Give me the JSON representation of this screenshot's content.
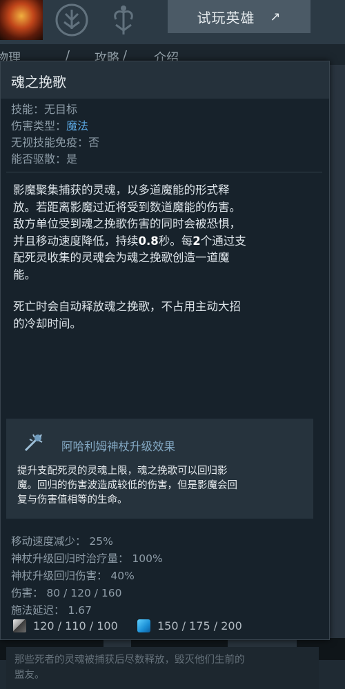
{
  "background": {
    "try_hero_button": "试玩英雄",
    "try_hero_arrow": "↗",
    "tab_fragments": [
      "物理",
      "/",
      "攻略",
      "/",
      "介绍"
    ]
  },
  "tooltip": {
    "title": "魂之挽歌",
    "info": {
      "ability_label": "技能：",
      "ability_value": "无目标",
      "damage_type_label": "伤害类型：",
      "damage_type_value": "魔法",
      "spell_immunity": "无视技能免疫：否",
      "dispellable": "能否驱散：是"
    },
    "description": {
      "p1_lines": [
        "影魔聚集捕获的灵魂，以多道魔能的形式释",
        "放。若距离影魔过近将受到数道魔能的伤害。",
        "敌方单位受到魂之挽歌伤害的同时会被恐惧，"
      ],
      "p1_line4_a": "并且移动速度降低，持续",
      "p1_line4_b": "0.8",
      "p1_line4_c": "秒。每",
      "p1_line4_d": "2",
      "p1_line4_e": "个通过支",
      "p1_lines_end": [
        "配死灵收集的灵魂会为魂之挽歌创造一道魔",
        "能。"
      ],
      "p2_lines": [
        "死亡时会自动释放魂之挽歌，不占用主动大招",
        "的冷却时间。"
      ]
    },
    "aghanim": {
      "icon": "aghanims-scepter-icon",
      "title": "阿哈利姆神杖升级效果",
      "lines": [
        "提升支配死灵的灵魂上限，魂之挽歌可以回归影",
        "魔。回归的伤害波造成较低的伤害，但是影魔会回",
        "复与伤害值相等的生命。"
      ]
    },
    "stats": [
      "移动速度减少： 25%",
      "神杖升级回归时治疗量： 100%",
      "神杖升级回归伤害： 40%",
      "伤害： 80 / 120 / 160",
      "施法延迟： 1.67"
    ],
    "cooldown": "120 / 110 / 100",
    "mana_cost": "150 / 175 / 200",
    "lore_lines": [
      "那些死者的灵魂被捕获后尽数释放，毁灭他们生前的",
      "盟友。"
    ]
  },
  "colors": {
    "magic_damage": "#5aa6e0",
    "aghanim_title": "#84a9c4",
    "tooltip_bg": "#17222b"
  }
}
